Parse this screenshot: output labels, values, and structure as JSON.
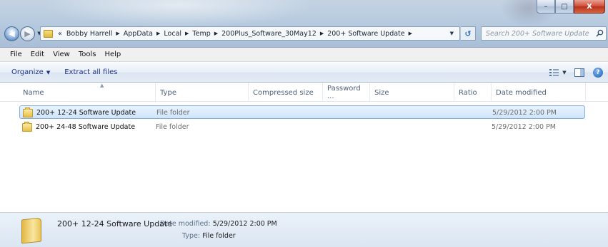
{
  "window": {
    "minimize_glyph": "–",
    "maximize_glyph": "□",
    "close_glyph": "X"
  },
  "address": {
    "overflow": "«",
    "crumbs": [
      "Bobby Harrell",
      "AppData",
      "Local",
      "Temp",
      "200Plus_Software_30May12",
      "200+ Software Update"
    ]
  },
  "search": {
    "placeholder": "Search 200+ Software Update"
  },
  "menu": {
    "file": "File",
    "edit": "Edit",
    "view": "View",
    "tools": "Tools",
    "help": "Help"
  },
  "commands": {
    "organize": "Organize",
    "extract": "Extract all files"
  },
  "columns": {
    "name": "Name",
    "type": "Type",
    "compressed_size": "Compressed size",
    "password": "Password ...",
    "size": "Size",
    "ratio": "Ratio",
    "date_modified": "Date modified"
  },
  "files": [
    {
      "name": "200+ 12-24 Software Update",
      "type": "File folder",
      "date": "5/29/2012 2:00 PM",
      "selected": true
    },
    {
      "name": "200+ 24-48 Software Update",
      "type": "File folder",
      "date": "5/29/2012 2:00 PM",
      "selected": false
    }
  ],
  "details": {
    "name": "200+ 12-24 Software Update",
    "modified_label": "Date modified:",
    "modified_value": "5/29/2012 2:00 PM",
    "type_label": "Type:",
    "type_value": "File folder"
  }
}
